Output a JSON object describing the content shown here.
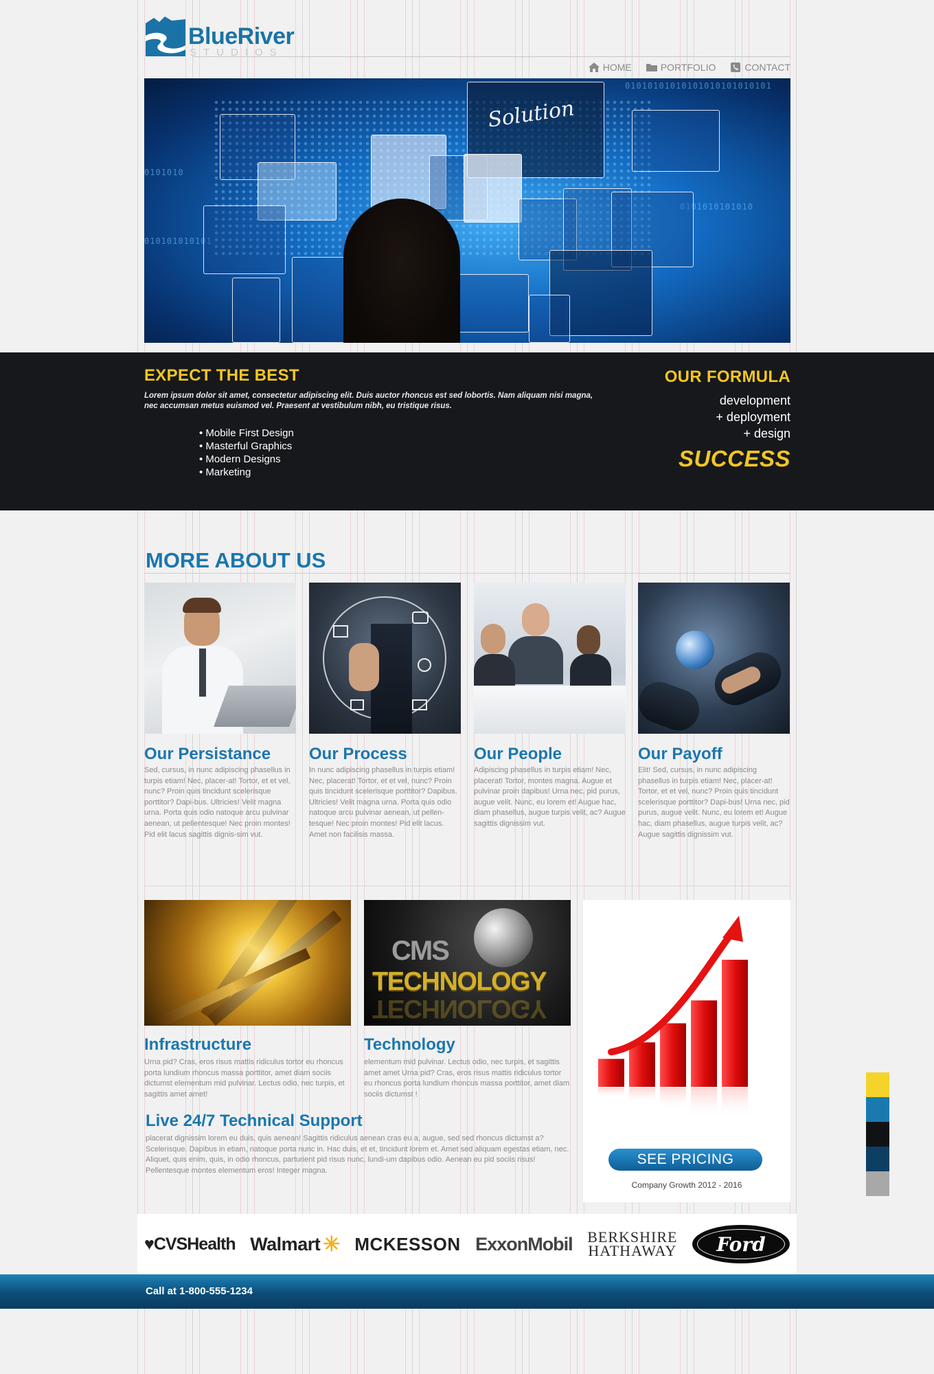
{
  "brand": {
    "name": "BlueRiver",
    "tagline": "STUDIOS"
  },
  "nav": [
    {
      "label": "HOME",
      "icon": "home-icon"
    },
    {
      "label": "PORTFOLIO",
      "icon": "folder-icon"
    },
    {
      "label": "CONTACT",
      "icon": "phone-icon"
    }
  ],
  "hero": {
    "overlay_text": "Solution"
  },
  "band": {
    "heading": "EXPECT THE BEST",
    "text": "Lorem ipsum dolor sit amet, consectetur adipiscing elit. Duis auctor rhoncus est sed lobortis. Nam aliquam nisi magna, nec accumsan metus euismod vel. Praesent at vestibulum nibh, eu tristique risus.",
    "list": [
      "Mobile First Design",
      "Masterful Graphics",
      "Modern Designs",
      "Marketing"
    ],
    "formula_heading": "OUR FORMULA",
    "formula_lines": [
      "development",
      "+ deployment",
      "+ design"
    ],
    "formula_result": "SUCCESS"
  },
  "about": {
    "title": "MORE ABOUT US",
    "cards": [
      {
        "title": "Our Persistance",
        "text": "Sed, cursus, in nunc adipiscing phasellus in turpis etiam! Nec, placer-at! Tortor, et et vel, nunc? Proin quis tincidunt scelerisque porttitor? Dapi-bus. Ultricies! Velit magna urna. Porta quis odio natoque arcu pulvinar aenean, ut pellentesque! Nec proin montes! Pid elit lacus sagittis dignis-sim vut."
      },
      {
        "title": "Our Process",
        "text": "In nunc adipiscing phasellus in turpis etiam! Nec, placerat! Tortor, et et vel, nunc? Proin quis tincidunt scelerisque porttitor? Dapibus. Ultricies! Velit magna urna. Porta quis odio natoque arcu pulvinar aenean, ut pellen-tesque! Nec proin montes! Pid elit lacus. Amet non facilisis massa."
      },
      {
        "title": "Our People",
        "text": "Adipiscing phasellus in turpis etiam! Nec, placerat! Tortor, montes magna. Augue et pulvinar proin dapibus! Urna nec, pid purus, augue velit. Nunc, eu lorem et! Augue hac, diam phasellus, augue turpis velit, ac? Augue sagittis dignissim vut."
      },
      {
        "title": "Our Payoff",
        "text": "Elit! Sed, cursus, in nunc adipiscing phasellus in turpis etiam! Nec, placer-at! Tortor, et et vel, nunc? Proin quis tincidunt scelerisque porttitor? Dapi-bus! Urna nec, pid purus, augue velit. Nunc, eu lorem et! Augue hac, diam phasellus, augue turpis velit, ac? Augue sagittis dignissim vut."
      }
    ]
  },
  "features": [
    {
      "title": "Infrastructure",
      "text": "Urna pid? Cras, eros risus mattis ridiculus tortor eu rhoncus porta lundium rhoncus massa porttitor, amet diam sociis dictumst elementum mid pulvinar. Lectus odio, nec turpis, et sagittis amet amet!"
    },
    {
      "title": "Technology",
      "image_text_top": "CMS",
      "image_text_bottom": "TECHNOLOGY",
      "text": "elementum mid pulvinar. Lectus odio, nec turpis, et sagittis amet amet Urna pid? Cras, eros risus mattis ridiculus tortor eu rhoncus porta lundium rhoncus massa porttitor, amet diam sociis dictumst !"
    }
  ],
  "support": {
    "title": "Live 24/7 Technical Support",
    "text": "placerat dignissim lorem eu duis, quis aenean! Sagittis ridiculus aenean cras eu a, augue, sed sed rhoncus dictumst a? Scelerisque. Dapibus in etiam, natoque porta nunc in. Hac duis, et et, tincidunt lorem et. Amet sed aliquam egestas etiam, nec. Aliquet, quis enim, quis, in odio rhoncus, parturient pid risus nunc, lundi-um dapibus odio. Aenean eu pid sociis risus! Pellentesque montes elementum eros! Integer magna."
  },
  "pricing": {
    "button": "SEE PRICING",
    "caption": "Company Growth  2012 - 2016",
    "bars": [
      0.22,
      0.35,
      0.5,
      0.68,
      1.0
    ]
  },
  "clients": {
    "cvs": "CVSHealth",
    "walmart": "Walmart",
    "mckesson": "MCKESSON",
    "exxon": "ExxonMobil",
    "berkshire_1": "BERKSHIRE",
    "berkshire_2": "HATHAWAY",
    "ford": "Ford"
  },
  "footer": {
    "text": "Call at 1-800-555-1234"
  },
  "colors": {
    "accent_blue": "#1b77ae",
    "accent_yellow": "#f2c623",
    "dark": "#17181c",
    "swatches": [
      "#f4d32a",
      "#1a7ab0",
      "#111215",
      "#0d3f62",
      "#a8a8a8"
    ]
  }
}
